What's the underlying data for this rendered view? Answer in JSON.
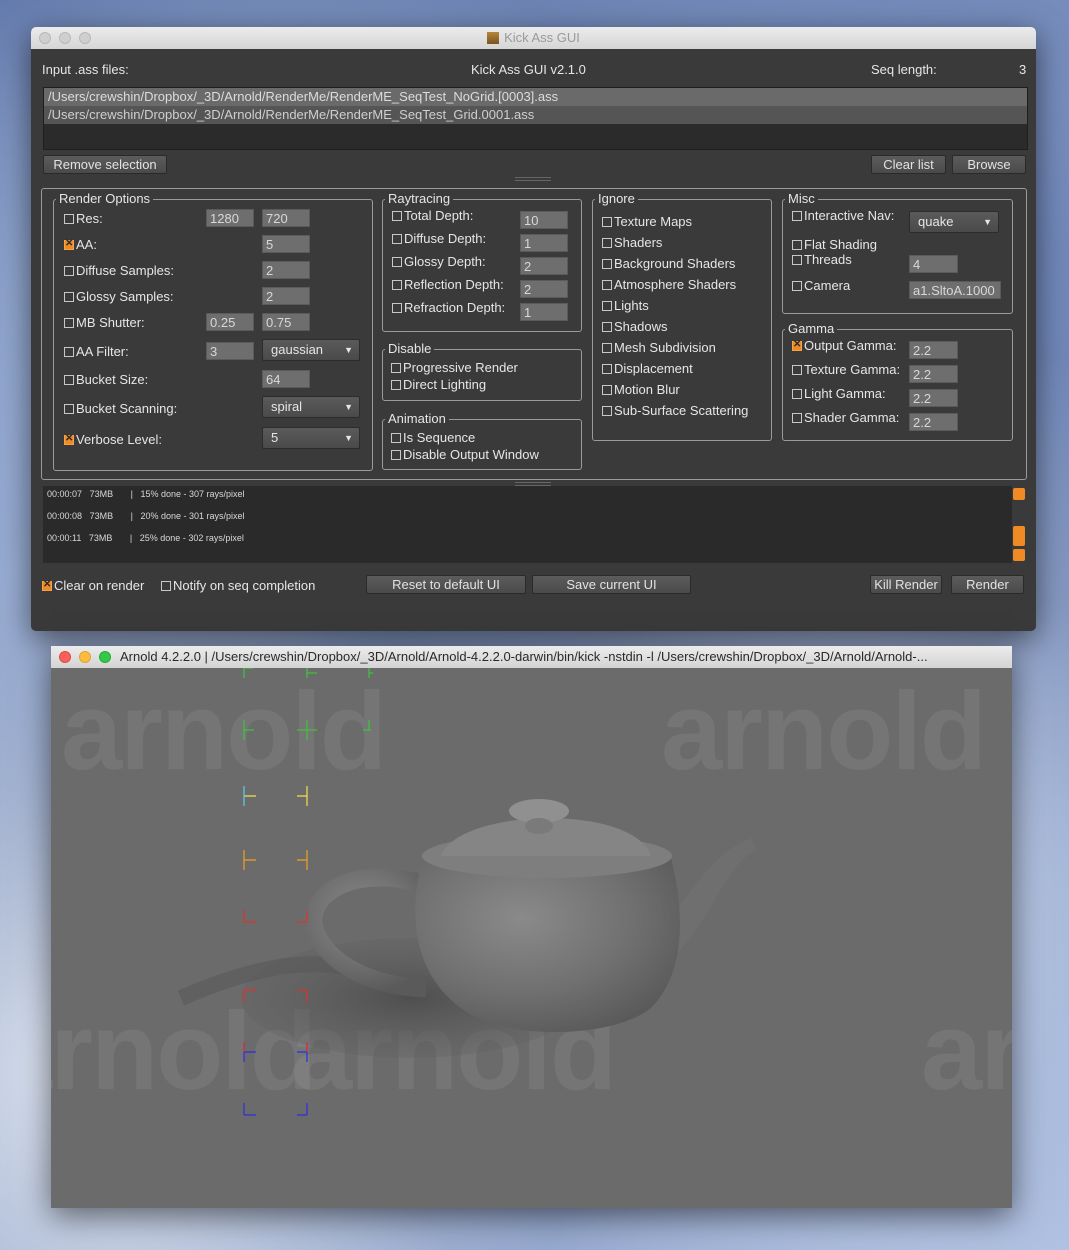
{
  "kick": {
    "window_title": "Kick Ass GUI",
    "header": {
      "input_label": "Input .ass files:",
      "app_title": "Kick Ass GUI v2.1.0",
      "seq_label": "Seq length:",
      "seq_value": "3"
    },
    "files": [
      "/Users/crewshin/Dropbox/_3D/Arnold/RenderMe/RenderME_SeqTest_NoGrid.[0003].ass",
      "/Users/crewshin/Dropbox/_3D/Arnold/RenderMe/RenderME_SeqTest_Grid.0001.ass"
    ],
    "buttons": {
      "remove_selection": "Remove selection",
      "clear_list": "Clear list",
      "browse": "Browse",
      "reset_default": "Reset to default UI",
      "save_current": "Save current UI",
      "kill_render": "Kill Render",
      "render": "Render"
    },
    "render_options": {
      "title": "Render Options",
      "res": {
        "label": "Res:",
        "w": "1280",
        "h": "720"
      },
      "aa": {
        "label": "AA:",
        "value": "5"
      },
      "diffuse_samples": {
        "label": "Diffuse Samples:",
        "value": "2"
      },
      "glossy_samples": {
        "label": "Glossy Samples:",
        "value": "2"
      },
      "mb_shutter": {
        "label": "MB Shutter:",
        "v1": "0.25",
        "v2": "0.75"
      },
      "aa_filter": {
        "label": "AA Filter:",
        "value": "3",
        "type": "gaussian"
      },
      "bucket_size": {
        "label": "Bucket Size:",
        "value": "64"
      },
      "bucket_scanning": {
        "label": "Bucket Scanning:",
        "value": "spiral"
      },
      "verbose_level": {
        "label": "Verbose Level:",
        "value": "5"
      }
    },
    "raytracing": {
      "title": "Raytracing",
      "total_depth": {
        "label": "Total Depth:",
        "value": "10"
      },
      "diffuse_depth": {
        "label": "Diffuse Depth:",
        "value": "1"
      },
      "glossy_depth": {
        "label": "Glossy Depth:",
        "value": "2"
      },
      "reflection_depth": {
        "label": "Reflection Depth:",
        "value": "2"
      },
      "refraction_depth": {
        "label": "Refraction Depth:",
        "value": "1"
      }
    },
    "disable": {
      "title": "Disable",
      "progressive": "Progressive Render",
      "direct_lighting": "Direct Lighting"
    },
    "animation": {
      "title": "Animation",
      "is_sequence": "Is Sequence",
      "disable_output": "Disable Output Window"
    },
    "ignore": {
      "title": "Ignore",
      "items": [
        "Texture Maps",
        "Shaders",
        "Background Shaders",
        "Atmosphere Shaders",
        "Lights",
        "Shadows",
        "Mesh Subdivision",
        "Displacement",
        "Motion Blur",
        "Sub-Surface Scattering"
      ]
    },
    "misc": {
      "title": "Misc",
      "interactive_nav": {
        "label": "Interactive Nav:",
        "value": "quake"
      },
      "flat_shading": "Flat Shading",
      "threads": {
        "label": "Threads",
        "value": "4"
      },
      "camera": {
        "label": "Camera",
        "value": "a1.SltoA.1000"
      }
    },
    "gamma": {
      "title": "Gamma",
      "output": {
        "label": "Output Gamma:",
        "value": "2.2"
      },
      "texture": {
        "label": "Texture Gamma:",
        "value": "2.2"
      },
      "light": {
        "label": "Light Gamma:",
        "value": "2.2"
      },
      "shader": {
        "label": "Shader Gamma:",
        "value": "2.2"
      }
    },
    "log": [
      {
        "time": "00:00:07",
        "mem": "73MB",
        "sep": "|",
        "msg": "15% done - 307 rays/pixel"
      },
      {
        "time": "00:00:08",
        "mem": "73MB",
        "sep": "|",
        "msg": "20% done - 301 rays/pixel"
      },
      {
        "time": "00:00:11",
        "mem": "73MB",
        "sep": "|",
        "msg": "25% done - 302 rays/pixel"
      }
    ],
    "footer": {
      "clear_on_render": "Clear on render",
      "notify": "Notify on seq completion"
    }
  },
  "arnold": {
    "window_title": "Arnold 4.2.2.0 | /Users/crewshin/Dropbox/_3D/Arnold/Arnold-4.2.2.0-darwin/bin/kick -nstdin -l /Users/crewshin/Dropbox/_3D/Arnold/Arnold-...",
    "watermark": "arnold"
  },
  "colors": {
    "accent": "#f08a24",
    "panel": "#3a3a3a",
    "render_bg": "#6b6b6b"
  }
}
